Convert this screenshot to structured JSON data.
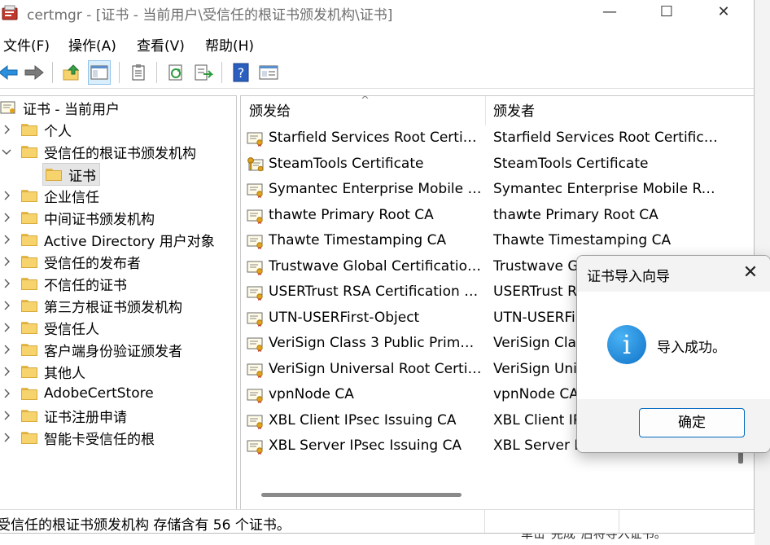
{
  "window": {
    "title": "certmgr - [证书 - 当前用户\\受信任的根证书颁发机构\\证书]",
    "controls": {
      "minimize": "—",
      "maximize": "☐",
      "close": "✕"
    }
  },
  "menu": [
    "文件(F)",
    "操作(A)",
    "查看(V)",
    "帮助(H)"
  ],
  "toolbar": [
    "back-icon",
    "forward-icon",
    "up-folder-icon",
    "show-hide-tree-icon",
    "clipboard-icon",
    "refresh-icon",
    "export-list-icon",
    "help-icon",
    "properties-icon"
  ],
  "tree": {
    "root": "证书 - 当前用户",
    "items": [
      {
        "label": "个人",
        "expanded": false
      },
      {
        "label": "受信任的根证书颁发机构",
        "expanded": true
      },
      {
        "label": "证书",
        "child": true,
        "selected": true
      },
      {
        "label": "企业信任",
        "expanded": false
      },
      {
        "label": "中间证书颁发机构",
        "expanded": false
      },
      {
        "label": "Active Directory 用户对象",
        "expanded": false
      },
      {
        "label": "受信任的发布者",
        "expanded": false
      },
      {
        "label": "不信任的证书",
        "expanded": false
      },
      {
        "label": "第三方根证书颁发机构",
        "expanded": false
      },
      {
        "label": "受信任人",
        "expanded": false
      },
      {
        "label": "客户端身份验证颁发者",
        "expanded": false
      },
      {
        "label": "其他人",
        "expanded": false
      },
      {
        "label": "AdobeCertStore",
        "expanded": false
      },
      {
        "label": "证书注册申请",
        "expanded": false
      },
      {
        "label": "智能卡受信任的根",
        "expanded": false
      }
    ]
  },
  "list": {
    "columns": [
      "颁发给",
      "颁发者"
    ],
    "sort_indicator": "^",
    "rows": [
      {
        "issued_to": "Starfield Services Root Certific...",
        "issued_by": "Starfield Services Root Certificat...",
        "key": false
      },
      {
        "issued_to": "SteamTools Certificate",
        "issued_by": "SteamTools Certificate",
        "key": true
      },
      {
        "issued_to": "Symantec Enterprise Mobile R...",
        "issued_by": "Symantec Enterprise Mobile Roo...",
        "key": false
      },
      {
        "issued_to": "thawte Primary Root CA",
        "issued_by": "thawte Primary Root CA",
        "key": false
      },
      {
        "issued_to": "Thawte Timestamping CA",
        "issued_by": "Thawte Timestamping CA",
        "key": false
      },
      {
        "issued_to": "Trustwave Global Certification ...",
        "issued_by": "Trustwave G",
        "key": false
      },
      {
        "issued_to": "USERTrust RSA Certification A...",
        "issued_by": "USERTrust R",
        "key": false
      },
      {
        "issued_to": "UTN-USERFirst-Object",
        "issued_by": "UTN-USERFi",
        "key": false
      },
      {
        "issued_to": "VeriSign Class 3 Public Primary...",
        "issued_by": "VeriSign Clas",
        "key": false
      },
      {
        "issued_to": "VeriSign Universal Root Certifi...",
        "issued_by": "VeriSign Uni",
        "key": false
      },
      {
        "issued_to": "vpnNode CA",
        "issued_by": "vpnNode CA",
        "key": false
      },
      {
        "issued_to": "XBL Client IPsec Issuing CA",
        "issued_by": "XBL Client IP",
        "key": false
      },
      {
        "issued_to": "XBL Server IPsec Issuing CA",
        "issued_by": "XBL Server IP",
        "key": false
      }
    ]
  },
  "status": "受信任的根证书颁发机构 存储含有 56 个证书。",
  "background": {
    "bottom_text": "单击\"完成\"后将导入证书。"
  },
  "dialog": {
    "title": "证书导入向导",
    "close": "✕",
    "icon": "info-icon",
    "icon_glyph": "i",
    "message": "导入成功。",
    "ok_label": "确定"
  },
  "colors": {
    "accent": "#0067c0",
    "selection_bg": "#e5e5e5",
    "toolbar_active": "#dbeefc",
    "dialog_chrome": "#f3f3f3"
  }
}
